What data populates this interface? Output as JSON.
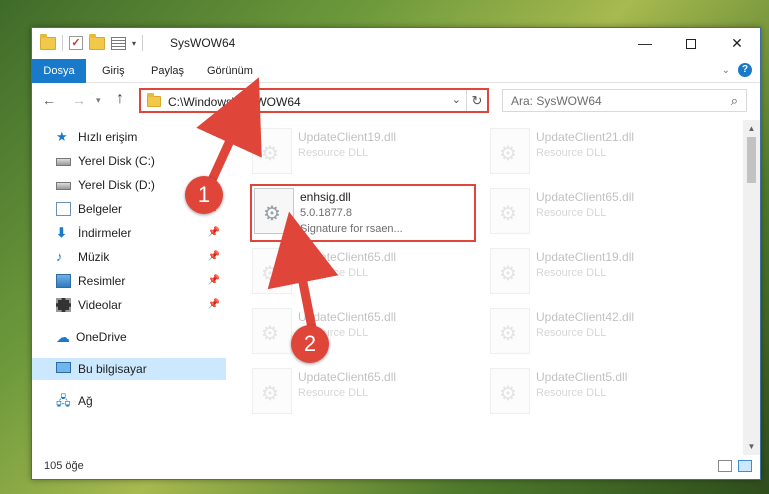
{
  "window": {
    "title": "SysWOW64",
    "controls": {
      "minimize": "—",
      "maximize": "",
      "close": "✕"
    }
  },
  "ribbon": {
    "tabs": [
      "Dosya",
      "Giriş",
      "Paylaş",
      "Görünüm"
    ],
    "help": "?"
  },
  "address": {
    "path": "C:\\Windows\\SysWOW64",
    "search_placeholder": "Ara: SysWOW64"
  },
  "navpane": {
    "items": [
      {
        "label": "Hızlı erişim",
        "icon": "star-icon",
        "pinned": false
      },
      {
        "label": "Yerel Disk (C:)",
        "icon": "disk-icon",
        "pinned": false
      },
      {
        "label": "Yerel Disk (D:)",
        "icon": "disk-icon",
        "pinned": false
      },
      {
        "label": "Belgeler",
        "icon": "documents-icon",
        "pinned": true
      },
      {
        "label": "İndirmeler",
        "icon": "download-icon",
        "pinned": true
      },
      {
        "label": "Müzik",
        "icon": "music-icon",
        "pinned": true
      },
      {
        "label": "Resimler",
        "icon": "pictures-icon",
        "pinned": true
      },
      {
        "label": "Videolar",
        "icon": "videos-icon",
        "pinned": true
      },
      {
        "label": "OneDrive",
        "icon": "cloud-icon",
        "pinned": false
      },
      {
        "label": "Bu bilgisayar",
        "icon": "computer-icon",
        "pinned": false
      },
      {
        "label": "Ağ",
        "icon": "network-icon",
        "pinned": false
      }
    ],
    "selected": "Bu bilgisayar"
  },
  "files": {
    "highlighted": {
      "name": "enhsig.dll",
      "version": "5.0.1877.8",
      "description": "Signature for rsaen..."
    },
    "faded": [
      {
        "name": "UpdateClient19.dll",
        "type": "Resource DLL"
      },
      {
        "name": "UpdateClient21.dll",
        "type": "Resource DLL"
      },
      {
        "name": "UpdateClient65.dll",
        "type": "Resource DLL"
      },
      {
        "name": "UpdateClient65.dll",
        "type": "Resource DLL"
      },
      {
        "name": "UpdateClient19.dll",
        "type": "Resource DLL"
      },
      {
        "name": "UpdateClient65.dll",
        "type": "Resource DLL"
      },
      {
        "name": "UpdateClient42.dll",
        "type": "Resource DLL"
      },
      {
        "name": "UpdateClient65.dll",
        "type": "Resource DLL"
      },
      {
        "name": "UpdateClient5.dll",
        "type": "Resource DLL"
      }
    ]
  },
  "status": {
    "item_count": "105 öğe"
  },
  "callouts": [
    "1",
    "2"
  ],
  "colors": {
    "accent": "#1979ca",
    "annotation": "#e0453a",
    "selected": "#cce8ff"
  }
}
